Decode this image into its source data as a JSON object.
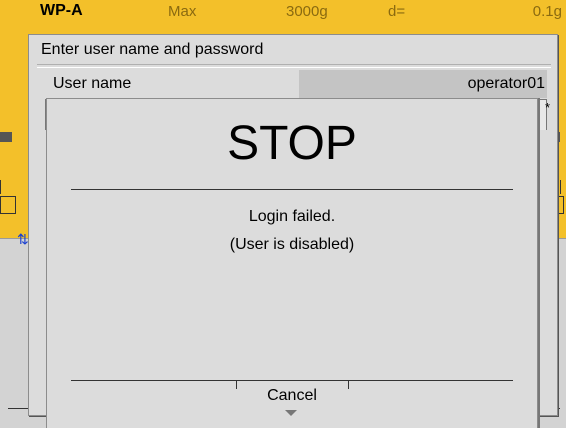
{
  "status_bar": {
    "model": "WP-A",
    "max_label": "Max",
    "capacity": "3000g",
    "d_label": "d=",
    "division": "0.1g"
  },
  "login_dialog": {
    "title": "Enter user name and password",
    "user_name_label": "User name",
    "user_name_value": "operator01",
    "password_mask": "*"
  },
  "stop_dialog": {
    "title": "STOP",
    "message_line1": "Login failed.",
    "message_line2": "(User is disabled)",
    "cancel_label": "Cancel"
  },
  "colors": {
    "accent_yellow": "#f3c02a",
    "dialog_gray": "#dcdcdc",
    "field_gray": "#c4c4c4",
    "usb_blue": "#1a3fd0"
  }
}
